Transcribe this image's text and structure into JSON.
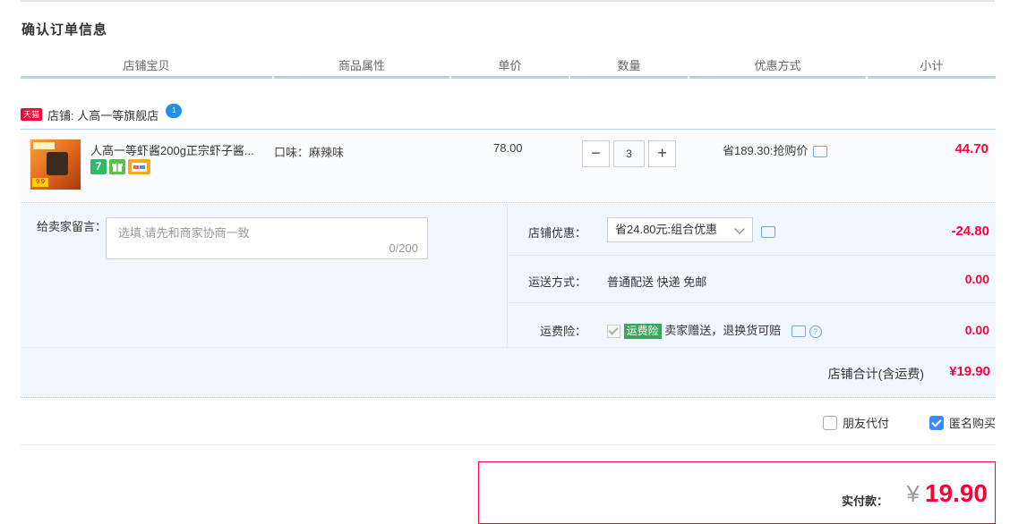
{
  "title": "确认订单信息",
  "columns": [
    "店铺宝贝",
    "商品属性",
    "单价",
    "数量",
    "优惠方式",
    "小计"
  ],
  "shop": {
    "badge": "天猫",
    "name": "店铺: 人高一等旗舰店",
    "wangwang": "1"
  },
  "item": {
    "thumb_badge": "9.9",
    "name": "人高一等虾酱200g正宗虾子酱...",
    "badges": [
      {
        "text": "7",
        "color": "#2fba67"
      },
      {
        "text": "",
        "color": "#5ac24a",
        "icon": "gift-icon"
      },
      {
        "text": "",
        "color": "#f5a623",
        "icon": "card-icon"
      }
    ],
    "attribute": "口味：麻辣味",
    "price": "78.00",
    "quantity": "3",
    "minus": "−",
    "plus": "+",
    "discount": "省189.30:抢购价",
    "subtotal": "44.70"
  },
  "memo": {
    "label": "给卖家留言：",
    "placeholder": "选填,请先和商家协商一致",
    "counter": "0/200"
  },
  "shop_discount": {
    "label": "店铺优惠：",
    "selected": "省24.80元:组合优惠",
    "value": "-24.80"
  },
  "shipping": {
    "label": "运送方式：",
    "text": "普通配送 快递 免邮",
    "value": "0.00"
  },
  "insurance": {
    "label": "运费险：",
    "tag": "运费险",
    "text": "卖家赠送，退换货可赔",
    "help": "?",
    "value": "0.00"
  },
  "shop_total": {
    "label": "店铺合计(含运费)",
    "value": "¥19.90"
  },
  "options": {
    "friend_pay": "朋友代付",
    "anonymous": "匿名购买"
  },
  "payment": {
    "label": "实付款：",
    "currency": "¥",
    "value": "19.90"
  }
}
